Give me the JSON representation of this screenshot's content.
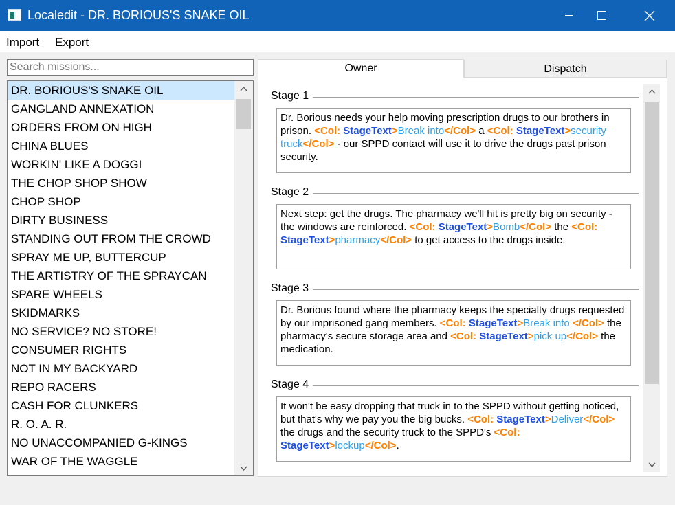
{
  "window": {
    "title": "Localedit - DR. BORIOUS'S SNAKE OIL",
    "icons": {
      "app": "app-icon",
      "minimize": "minimize-icon",
      "maximize": "maximize-icon",
      "close": "close-icon"
    }
  },
  "menu": {
    "import": "Import",
    "export": "Export"
  },
  "search": {
    "placeholder": "Search missions...",
    "value": ""
  },
  "missions": [
    "DR. BORIOUS'S SNAKE OIL",
    "GANGLAND ANNEXATION",
    "ORDERS FROM ON HIGH",
    "CHINA BLUES",
    "WORKIN' LIKE A DOGGI",
    "THE CHOP SHOP SHOW",
    "CHOP SHOP",
    "DIRTY BUSINESS",
    "STANDING OUT FROM THE CROWD",
    "SPRAY ME UP, BUTTERCUP",
    "THE ARTISTRY OF THE SPRAYCAN",
    "SPARE WHEELS",
    "SKIDMARKS",
    "NO SERVICE? NO STORE!",
    "CONSUMER RIGHTS",
    "NOT IN MY BACKYARD",
    "REPO RACERS",
    "CASH FOR CLUNKERS",
    "R. O. A. R.",
    "NO UNACCOMPANIED G-KINGS",
    "WAR OF THE WAGGLE"
  ],
  "selected_mission": "DR. BORIOUS'S SNAKE OIL",
  "tabs": {
    "active": "Owner",
    "owner": "Owner",
    "dispatch": "Dispatch"
  },
  "colors": {
    "tag": "#ff7f00",
    "tag_name": "#1f4fe0",
    "value": "#2fa0e8",
    "titlebar": "#1163b7",
    "selection": "#cce8ff"
  },
  "stages": [
    {
      "label": "Stage 1",
      "segments": [
        {
          "t": "Dr. Borious needs your help moving prescription drugs to our brothers in prison. ",
          "c": "plain"
        },
        {
          "t": "<Col: ",
          "c": "tag"
        },
        {
          "t": "StageText",
          "c": "name"
        },
        {
          "t": ">",
          "c": "tag"
        },
        {
          "t": "Break into",
          "c": "val"
        },
        {
          "t": "</Col>",
          "c": "tag"
        },
        {
          "t": " a ",
          "c": "plain"
        },
        {
          "t": "<Col: ",
          "c": "tag"
        },
        {
          "t": "StageText",
          "c": "name"
        },
        {
          "t": ">",
          "c": "tag"
        },
        {
          "t": "security truck",
          "c": "val"
        },
        {
          "t": "</Col>",
          "c": "tag"
        },
        {
          "t": " - our SPPD contact will use it to drive the drugs past prison security.",
          "c": "plain"
        }
      ]
    },
    {
      "label": "Stage 2",
      "segments": [
        {
          "t": "Next step: get the drugs. The pharmacy we'll hit is pretty big on security - the windows are reinforced. ",
          "c": "plain"
        },
        {
          "t": "<Col: ",
          "c": "tag"
        },
        {
          "t": "StageText",
          "c": "name"
        },
        {
          "t": ">",
          "c": "tag"
        },
        {
          "t": "Bomb",
          "c": "val"
        },
        {
          "t": "</Col>",
          "c": "tag"
        },
        {
          "t": " the ",
          "c": "plain"
        },
        {
          "t": "<Col: ",
          "c": "tag"
        },
        {
          "t": "StageText",
          "c": "name"
        },
        {
          "t": ">",
          "c": "tag"
        },
        {
          "t": "pharmacy",
          "c": "val"
        },
        {
          "t": "</Col>",
          "c": "tag"
        },
        {
          "t": " to get access to the drugs inside.",
          "c": "plain"
        }
      ]
    },
    {
      "label": "Stage 3",
      "segments": [
        {
          "t": "Dr. Borious found where the pharmacy keeps the specialty drugs requested by our imprisoned gang members. ",
          "c": "plain"
        },
        {
          "t": "<Col: ",
          "c": "tag"
        },
        {
          "t": "StageText",
          "c": "name"
        },
        {
          "t": ">",
          "c": "tag"
        },
        {
          "t": "Break into ",
          "c": "val"
        },
        {
          "t": "</Col>",
          "c": "tag"
        },
        {
          "t": " the pharmacy's secure storage area and ",
          "c": "plain"
        },
        {
          "t": "<Col: ",
          "c": "tag"
        },
        {
          "t": "StageText",
          "c": "name"
        },
        {
          "t": ">",
          "c": "tag"
        },
        {
          "t": "pick up",
          "c": "val"
        },
        {
          "t": "</Col>",
          "c": "tag"
        },
        {
          "t": " the medication.",
          "c": "plain"
        }
      ]
    },
    {
      "label": "Stage 4",
      "segments": [
        {
          "t": "It won't be easy dropping that truck in to the SPPD without getting noticed, but that's why we pay you the big bucks. ",
          "c": "plain"
        },
        {
          "t": "<Col: ",
          "c": "tag"
        },
        {
          "t": "StageText",
          "c": "name"
        },
        {
          "t": ">",
          "c": "tag"
        },
        {
          "t": "Deliver",
          "c": "val"
        },
        {
          "t": "</Col>",
          "c": "tag"
        },
        {
          "t": " the drugs and the security truck to the SPPD's ",
          "c": "plain"
        },
        {
          "t": "<Col: ",
          "c": "tag"
        },
        {
          "t": "StageText",
          "c": "name"
        },
        {
          "t": ">",
          "c": "tag"
        },
        {
          "t": "lockup",
          "c": "val"
        },
        {
          "t": "</Col>",
          "c": "tag"
        },
        {
          "t": ".",
          "c": "plain"
        }
      ]
    }
  ]
}
